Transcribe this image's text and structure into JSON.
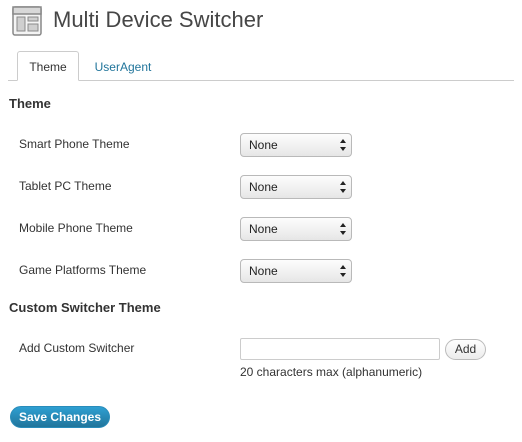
{
  "header": {
    "title": "Multi Device Switcher",
    "icon": "settings-page-icon"
  },
  "tabs": [
    {
      "label": "Theme",
      "active": true
    },
    {
      "label": "UserAgent",
      "active": false
    }
  ],
  "theme_section": {
    "heading": "Theme",
    "fields": [
      {
        "label": "Smart Phone Theme",
        "value": "None"
      },
      {
        "label": "Tablet PC Theme",
        "value": "None"
      },
      {
        "label": "Mobile Phone Theme",
        "value": "None"
      },
      {
        "label": "Game Platforms Theme",
        "value": "None"
      }
    ]
  },
  "custom_section": {
    "heading": "Custom Switcher Theme",
    "label": "Add Custom Switcher",
    "input_value": "",
    "add_label": "Add",
    "hint": "20 characters max (alphanumeric)"
  },
  "save_label": "Save Changes",
  "colors": {
    "link": "#21759b",
    "primary_button": "#21759b",
    "border": "#cccccc"
  }
}
